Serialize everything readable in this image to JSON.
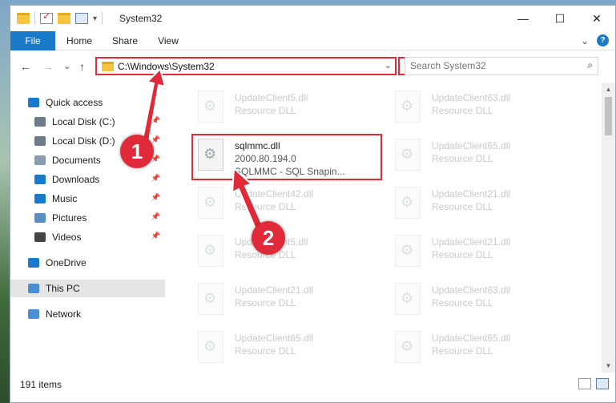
{
  "window": {
    "title": "System32",
    "controls": {
      "minimize": "—",
      "maximize": "☐",
      "close": "✕"
    }
  },
  "ribbon": {
    "tabs": [
      "File",
      "Home",
      "Share",
      "View"
    ],
    "expand_glyph": "⌄",
    "help_glyph": "?"
  },
  "nav": {
    "back": "←",
    "forward": "→",
    "recent": "⌄",
    "up": "↑",
    "address": "C:\\Windows\\System32",
    "address_dropdown": "⌄",
    "refresh": "↻",
    "search_placeholder": "Search System32",
    "search_glyph": "⌕"
  },
  "sidebar": {
    "items": [
      {
        "label": "Quick access",
        "icon": "star-icon",
        "color": "#1979ca",
        "pinned": false
      },
      {
        "label": "Local Disk (C:)",
        "icon": "drive-icon",
        "color": "#6d7c8a",
        "pinned": true
      },
      {
        "label": "Local Disk (D:)",
        "icon": "drive-icon",
        "color": "#6d7c8a",
        "pinned": true
      },
      {
        "label": "Documents",
        "icon": "documents-icon",
        "color": "#8a9bb0",
        "pinned": true
      },
      {
        "label": "Downloads",
        "icon": "download-icon",
        "color": "#1979ca",
        "pinned": true
      },
      {
        "label": "Music",
        "icon": "music-icon",
        "color": "#1979ca",
        "pinned": true
      },
      {
        "label": "Pictures",
        "icon": "pictures-icon",
        "color": "#5b8ec2",
        "pinned": true
      },
      {
        "label": "Videos",
        "icon": "videos-icon",
        "color": "#444444",
        "pinned": true
      },
      {
        "label": "OneDrive",
        "icon": "cloud-icon",
        "color": "#1979ca",
        "pinned": false
      },
      {
        "label": "This PC",
        "icon": "computer-icon",
        "color": "#4a8fd4",
        "pinned": false
      },
      {
        "label": "Network",
        "icon": "network-icon",
        "color": "#4a8fd4",
        "pinned": false
      }
    ],
    "pin_glyph": "📌"
  },
  "files": [
    {
      "name": "UpdateClient5.dll",
      "sub": "Resource DLL",
      "faded": true
    },
    {
      "name": "UpdateClient63.dll",
      "sub": "Resource DLL",
      "faded": true
    },
    {
      "name": "sqlmmc.dll",
      "sub": "2000.80.194.0",
      "sub2": "SQLMMC - SQL Snapin...",
      "faded": false
    },
    {
      "name": "UpdateClient65.dll",
      "sub": "Resource DLL",
      "faded": true
    },
    {
      "name": "UpdateClient42.dll",
      "sub": "Resource DLL",
      "faded": true
    },
    {
      "name": "UpdateClient21.dll",
      "sub": "Resource DLL",
      "faded": true
    },
    {
      "name": "UpdateClient5.dll",
      "sub": "Resource DLL",
      "faded": true
    },
    {
      "name": "UpdateClient21.dll",
      "sub": "Resource DLL",
      "faded": true
    },
    {
      "name": "UpdateClient21.dll",
      "sub": "Resource DLL",
      "faded": true
    },
    {
      "name": "UpdateClient63.dll",
      "sub": "Resource DLL",
      "faded": true
    },
    {
      "name": "UpdateClient65.dll",
      "sub": "Resource DLL",
      "faded": true
    },
    {
      "name": "UpdateClient65.dll",
      "sub": "Resource DLL",
      "faded": true
    }
  ],
  "status": {
    "count": "191 items"
  },
  "annotations": {
    "step1": "1",
    "step2": "2",
    "accent": "#e02a3a"
  }
}
